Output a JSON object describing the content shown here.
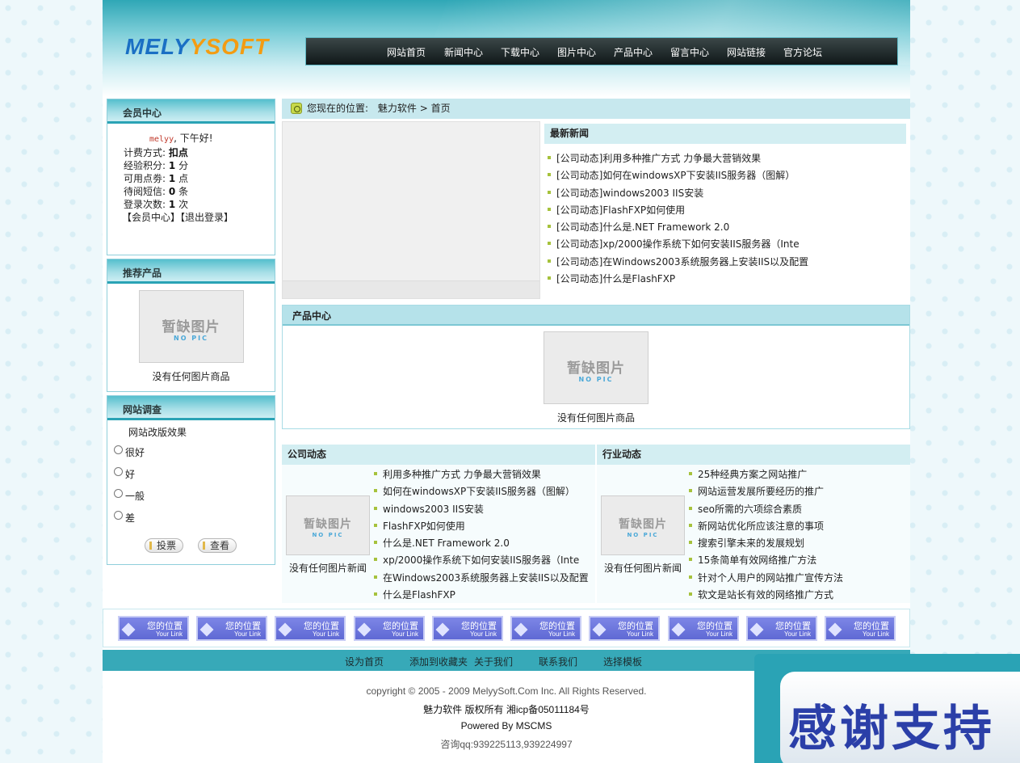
{
  "header": {
    "logo_main": "MELY",
    "logo_accent": "YSOFT",
    "nav": [
      "网站首页",
      "新闻中心",
      "下载中心",
      "图片中心",
      "产品中心",
      "留言中心",
      "网站链接",
      "官方论坛"
    ]
  },
  "member": {
    "title": "会员中心",
    "username": "melyy",
    "greeting": ", 下午好!",
    "rows": [
      {
        "label": "计费方式:",
        "value": "扣点",
        "unit": ""
      },
      {
        "label": "经验积分:",
        "value": "1",
        "unit": "分"
      },
      {
        "label": "可用点劵:",
        "value": "1",
        "unit": "点"
      },
      {
        "label": "待阅短信:",
        "value": "0",
        "unit": "条"
      },
      {
        "label": "登录次数:",
        "value": "1",
        "unit": "次"
      }
    ],
    "link_center": "【会员中心】",
    "link_logout": "【退出登录】"
  },
  "recommend": {
    "title": "推荐产品",
    "no_pic_cn": "暂缺图片",
    "no_pic_en": "NO PIC",
    "caption": "没有任何图片商品"
  },
  "survey": {
    "title": "网站调查",
    "question": "网站改版效果",
    "options": [
      "很好",
      "好",
      "一般",
      "差"
    ],
    "vote_label": "投票",
    "view_label": "查看"
  },
  "breadcrumb": {
    "prefix": "您现在的位置:",
    "site": "魅力软件",
    "sep": ">",
    "current": "首页"
  },
  "latest_news": {
    "title": "最新新闻",
    "items": [
      "[公司动态]利用多种推广方式 力争最大营销效果",
      "[公司动态]如何在windowsXP下安装IIS服务器（图解）",
      "[公司动态]windows2003 IIS安装",
      "[公司动态]FlashFXP如何使用",
      "[公司动态]什么是.NET Framework 2.0",
      "[公司动态]xp/2000操作系统下如何安装IIS服务器（Inte",
      "[公司动态]在Windows2003系统服务器上安装IIS以及配置",
      "[公司动态]什么是FlashFXP"
    ]
  },
  "products": {
    "title": "产品中心",
    "caption": "没有任何图片商品"
  },
  "company_news": {
    "title": "公司动态",
    "caption": "没有任何图片新闻",
    "items": [
      "利用多种推广方式 力争最大营销效果",
      "如何在windowsXP下安装IIS服务器（图解）",
      "windows2003 IIS安装",
      "FlashFXP如何使用",
      "什么是.NET Framework 2.0",
      "xp/2000操作系统下如何安装IIS服务器（Inte",
      "在Windows2003系统服务器上安装IIS以及配置",
      "什么是FlashFXP"
    ]
  },
  "industry_news": {
    "title": "行业动态",
    "caption": "没有任何图片新闻",
    "items": [
      "25种经典方案之网站推广",
      "网站运营发展所要经历的推广",
      "seo所需的六项综合素质",
      "新网站优化所应该注意的事项",
      "搜索引擎未来的发展规划",
      "15条简单有效网络推广方法",
      "针对个人用户的网站推广宣传方法",
      "软文是站长有效的网络推广方式"
    ]
  },
  "friend_links": {
    "label_cn": "您的位置",
    "label_en": "Your Link",
    "count_items": [
      1,
      2,
      3,
      4,
      5,
      6,
      7,
      8,
      9,
      10
    ]
  },
  "footer_nav": [
    "设为首页",
    "添加到收藏夹",
    "关于我们",
    "联系我们",
    "选择模板"
  ],
  "footer": {
    "copyright": "copyright © 2005 - 2009 MelyySoft.Com Inc. All Rights Reserved.",
    "owner_name": "魅力软件",
    "owner_rest": " 版权所有 湘icp备05011184号",
    "powered": "Powered By MSCMS",
    "qq": "咨询qq:939225113,939224997"
  },
  "popup": {
    "text": "感谢支持"
  }
}
